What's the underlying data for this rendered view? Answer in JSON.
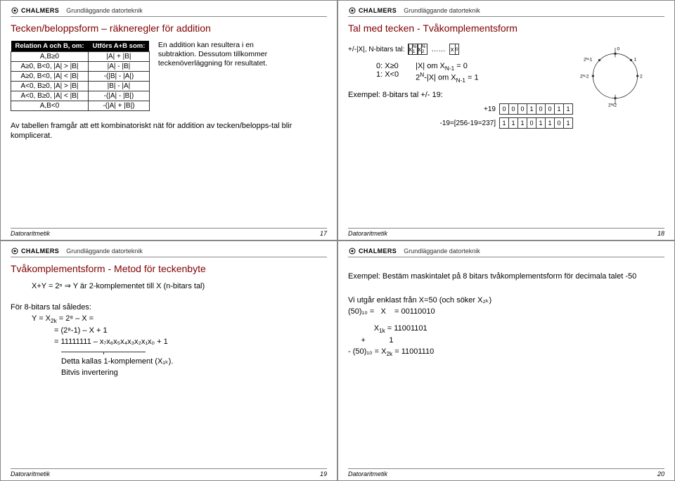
{
  "common": {
    "logo_text": "CHALMERS",
    "course": "Grundläggande datorteknik",
    "footer_label": "Datoraritmetik"
  },
  "slide17": {
    "title": "Tecken/beloppsform – räkneregler för addition",
    "table": {
      "hd1": "Relation A och B, om:",
      "hd2": "Utförs A+B som:",
      "rows": [
        [
          "A,B≥0",
          "|A| + |B|"
        ],
        [
          "A≥0, B<0, |A| > |B|",
          "|A| - |B|"
        ],
        [
          "A≥0, B<0, |A| < |B|",
          "-(|B| - |A|)"
        ],
        [
          "A<0, B≥0, |A| > |B|",
          "|B| - |A|"
        ],
        [
          "A<0, B≥0, |A| < |B|",
          "-(|A| - |B|)"
        ],
        [
          "A,B<0",
          "-(|A| + |B|)"
        ]
      ]
    },
    "note": "En addition kan resultera i en subtraktion. Dessutom tillkommer teckenöverläggning för resultatet.",
    "para": "Av tabellen framgår att ett kombinatoriskt nät för addition av tecken/belopps-tal blir komplicerat.",
    "page": "17"
  },
  "slide18": {
    "title": "Tal med tecken - Tvåkomplementsform",
    "lineA_prefix": "+/-|X|, N-bitars tal:",
    "bitlabels": [
      "x",
      "x",
      "x"
    ],
    "bitsubs": [
      "N-1",
      "N-2",
      "0"
    ],
    "dots": "……",
    "cond0": "0: X≥0",
    "cond1": "1: X<0",
    "rhs0_a": "|X| om X",
    "rhs0_b": "N-1",
    "rhs0_c": " = 0",
    "rhs1_a": "2",
    "rhs1_b": "N",
    "rhs1_c": "-|X| om X",
    "rhs1_d": "N-1",
    "rhs1_e": " = 1",
    "example_label": "Exempel: 8-bitars tal +/- 19:",
    "plus19": "+19",
    "plus19bits": [
      "0",
      "0",
      "0",
      "1",
      "0",
      "0",
      "1",
      "1"
    ],
    "minus19": "-19=[256-19=237]",
    "minus19bits": [
      "1",
      "1",
      "1",
      "0",
      "1",
      "1",
      "0",
      "1"
    ],
    "circ": {
      "top": "0",
      "r1": "1",
      "r2": "2",
      "l1": "2ᴺ-1",
      "l2": "2ᴺ-2",
      "bottom": "2ᴺ/2"
    },
    "page": "18"
  },
  "slide19": {
    "title": "Tvåkomplementsform - Metod för teckenbyte",
    "lineA": "X+Y = 2ⁿ ⇒ Y är 2-komplementet till X (n-bitars tal)",
    "lineB": "För 8-bitars tal således:",
    "eq1_l": "Y = X",
    "eq1_sub": "2k",
    "eq1_r": " = 2⁸ – X =",
    "eq2": "= (2⁸-1) – X + 1",
    "eq3": "= 11111111 – x₇x₆x₅x₄x₃x₂x₁x₀ + 1",
    "brace_label": "Detta kallas 1-komplement (X₁ₖ).",
    "brace_sub": "Bitvis invertering",
    "page": "19"
  },
  "slide20": {
    "example": "Exempel: Bestäm maskintalet på 8 bitars tvåkomplementsform för decimala talet -50",
    "l1": "Vi utgår enklast från X=50 (och söker X₂ₖ)",
    "l2": "(50)₁₀ =   X    = 00110010",
    "l3_a": "X",
    "l3_sub": "1k",
    "l3_b": " = 11001101",
    "l4": "      +           1",
    "l5_a": "- (50)₁₀ = X",
    "l5_sub": "2k",
    "l5_b": " = 11001110",
    "page": "20"
  }
}
